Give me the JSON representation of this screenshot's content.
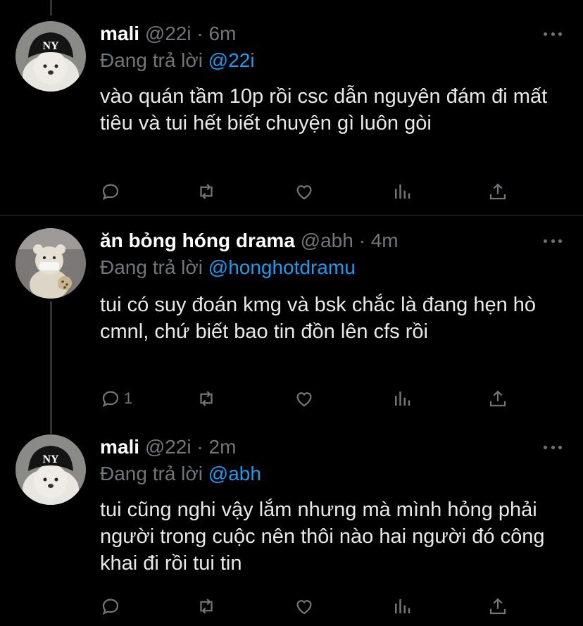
{
  "tweets": [
    {
      "name": "mali",
      "handle": "@22i",
      "time": "· 6m",
      "replying_prefix": "Đang trả lời",
      "replying_to": "@22i",
      "text": "vào quán tầm 10p rồi csc dẫn nguyên đám đi mất tiêu và tui hết biết chuyện gì luôn gòi",
      "reply_count": ""
    },
    {
      "name": "ăn bỏng hóng drama",
      "handle": "@abh",
      "time": "· 4m",
      "replying_prefix": "Đang trả lời",
      "replying_to": "@honghotdramu",
      "text": "tui có suy đoán kmg và bsk chắc là đang hẹn hò cmnl, chứ biết bao tin đồn lên cfs rồi",
      "reply_count": "1"
    },
    {
      "name": "mali",
      "handle": "@22i",
      "time": "· 2m",
      "replying_prefix": "Đang trả lời",
      "replying_to": "@abh",
      "text": "tui cũng nghi vậy lắm nhưng mà mình hỏng phải người trong cuộc nên thôi nào hai người đó công khai đi rồi tui tin",
      "reply_count": ""
    }
  ],
  "colors": {
    "background": "#000000",
    "text": "#e7e9ea",
    "muted": "#71767b",
    "link": "#1d9bf0",
    "divider": "#2f3336"
  },
  "icons": [
    "reply-icon",
    "retweet-icon",
    "like-icon",
    "analytics-icon",
    "share-icon",
    "more-icon"
  ]
}
